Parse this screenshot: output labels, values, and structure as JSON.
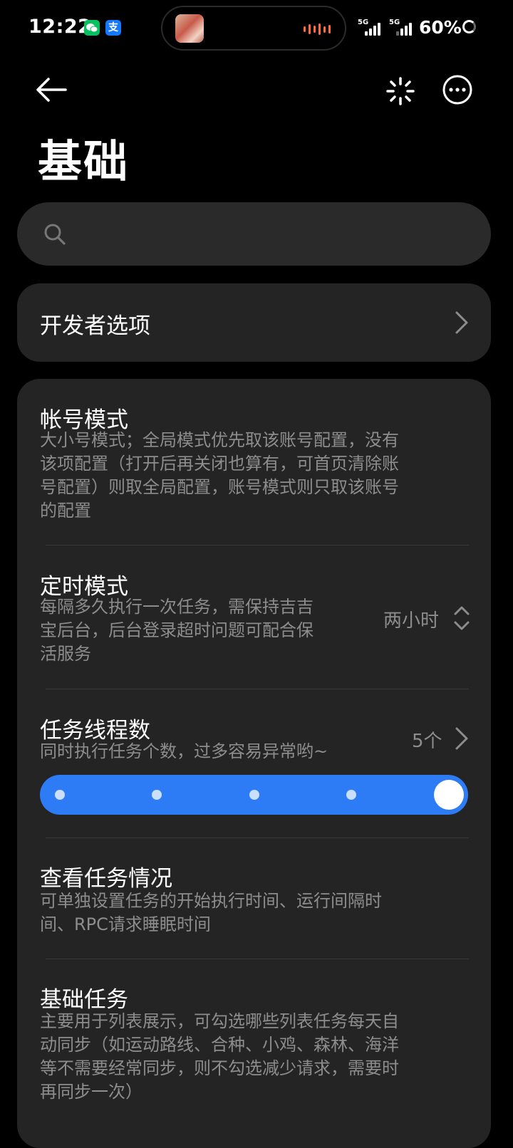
{
  "status_bar": {
    "time": "12:22",
    "wechat_icon": "wechat-icon",
    "alipay_icon": "alipay-icon",
    "alipay_glyph": "支",
    "network1": "5G",
    "network2": "5G",
    "battery": "60%"
  },
  "header": {
    "back_icon": "arrow-left-icon",
    "sparkle_icon": "sparkle-icon",
    "more_icon": "more-horizontal-icon",
    "title": "基础"
  },
  "search": {
    "placeholder": ""
  },
  "developer_options": {
    "label": "开发者选项"
  },
  "settings": {
    "account_mode": {
      "title": "帐号模式",
      "desc_lines": [
        "大小号模式；全局模式优先取该账号配置，没有",
        "该项配置（打开后再关闭也算有，可首页清除账",
        "号配置）则取全局配置，账号模式则只取该账号",
        "的配置"
      ]
    },
    "timer_mode": {
      "title": "定时模式",
      "desc_lines": [
        "每隔多久执行一次任务，需保持吉吉",
        "宝后台，后台登录超时问题可配合保",
        "活服务"
      ],
      "value": "两小时"
    },
    "thread_count": {
      "title": "任务线程数",
      "desc": "同时执行任务个数，过多容易异常哟~",
      "value": "5个",
      "slider": {
        "min": 1,
        "max": 5,
        "current": 5,
        "accent": "#2d7cf6"
      }
    },
    "view_tasks": {
      "title": "查看任务情况",
      "desc_lines": [
        "可单独设置任务的开始执行时间、运行间隔时",
        "间、RPC请求睡眠时间"
      ]
    },
    "basic_tasks": {
      "title": "基础任务",
      "desc_lines": [
        "主要用于列表展示，可勾选哪些列表任务每天自",
        "动同步（如运动路线、合种、小鸡、森林、海洋",
        "等不需要经常同步，则不勾选减少请求，需要时",
        "再同步一次）"
      ]
    }
  },
  "colors": {
    "background": "#000000",
    "card": "#242424",
    "search": "#2a2a2a",
    "secondary_text": "#8d8d8d",
    "accent": "#2d7cf6"
  }
}
